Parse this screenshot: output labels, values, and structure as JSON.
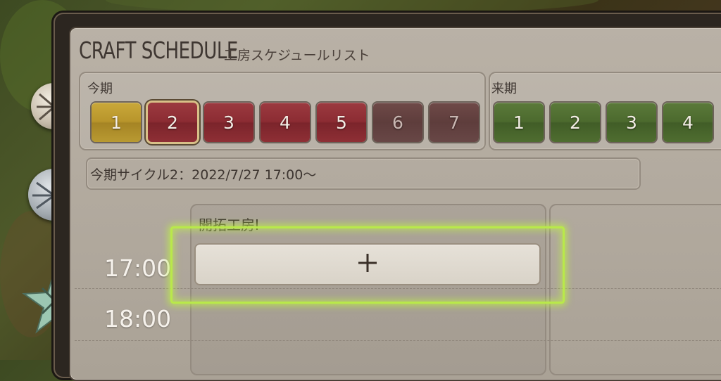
{
  "window": {
    "title": "CRAFT SCHEDULE",
    "subtitle": "工房スケジュールリスト"
  },
  "current_period": {
    "label": "今期",
    "cycles": [
      "1",
      "2",
      "3",
      "4",
      "5",
      "6",
      "7"
    ],
    "selected_cycle": "2"
  },
  "next_period": {
    "label": "来期",
    "cycles": [
      "1",
      "2",
      "3",
      "4"
    ]
  },
  "cycle_info": "今期サイクル2：2022/7/27 17:00～",
  "schedule": {
    "workshop_title": "開拓工房Ⅰ",
    "times": [
      "17:00",
      "18:00"
    ],
    "add_slot_icon": "plus-icon"
  },
  "colors": {
    "highlight": "#b9e94a",
    "cycle_gold": "#b8952b",
    "cycle_red": "#8c2c33",
    "cycle_green": "#4c6a2e"
  }
}
